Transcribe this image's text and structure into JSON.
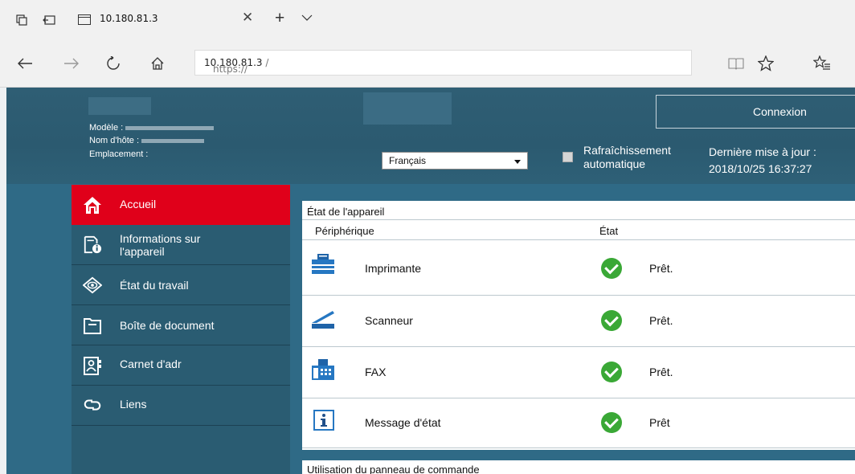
{
  "browser": {
    "tab_title": "10.180.81.3",
    "url_protocol": "https://",
    "url_host": "10.180.81.3",
    "url_path": " /"
  },
  "header": {
    "model_label": "Modèle :",
    "hostname_label": "Nom d'hôte :",
    "location_label": "Emplacement :",
    "language_selected": "Français",
    "refresh_label_line1": "Rafraîchissement",
    "refresh_label_line2": "automatique",
    "last_update_label": "Dernière mise à jour :",
    "last_update_value": "2018/10/25 16:37:27",
    "login_button": "Connexion"
  },
  "sidebar": {
    "items": [
      {
        "label": "Accueil",
        "icon": "home-icon"
      },
      {
        "label_line1": "Informations sur",
        "label_line2": "l'appareil",
        "icon": "device-info-icon"
      },
      {
        "label": "État du travail",
        "icon": "eye-icon"
      },
      {
        "label": "Boîte de document",
        "icon": "folder-icon"
      },
      {
        "label": "Carnet d'adr",
        "icon": "address-book-icon"
      },
      {
        "label": "Liens",
        "icon": "link-icon"
      }
    ]
  },
  "device_status": {
    "title": "État de l'appareil",
    "col_device": "Périphérique",
    "col_state": "État",
    "rows": [
      {
        "name": "Imprimante",
        "status": "Prêt.",
        "icon": "printer-icon"
      },
      {
        "name": "Scanneur",
        "status": "Prêt.",
        "icon": "scanner-icon"
      },
      {
        "name": "FAX",
        "status": "Prêt.",
        "icon": "fax-icon"
      },
      {
        "name": "Message d'état",
        "status": "Prêt",
        "icon": "info-icon"
      }
    ]
  },
  "control_panel": {
    "title": "Utilisation du panneau de commande"
  },
  "colors": {
    "header_bg": "#2f5e74",
    "active_red": "#e0001a",
    "check_green": "#3aa836"
  }
}
